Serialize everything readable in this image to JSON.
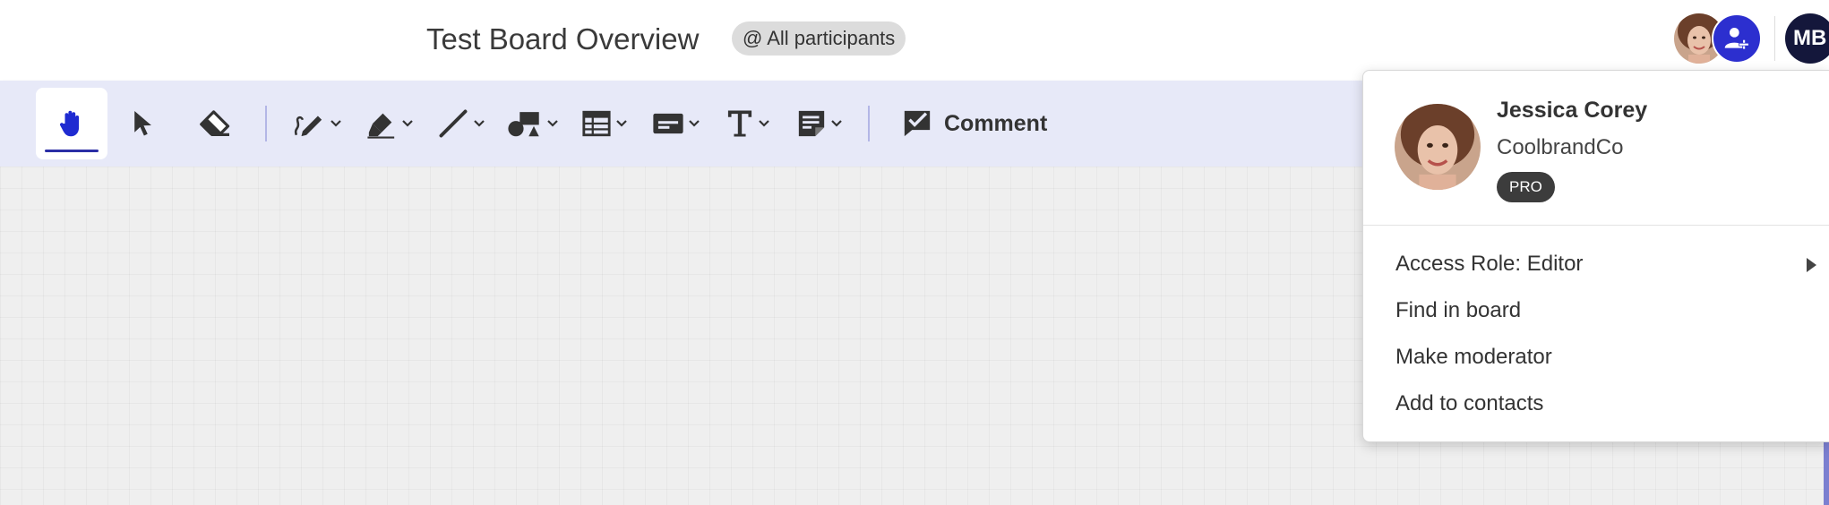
{
  "header": {
    "board_title": "Test Board Overview",
    "participants_chip": "@ All participants",
    "current_user_initials": "MB"
  },
  "toolbar": {
    "tools": [
      {
        "name": "hand-tool",
        "icon": "hand-icon",
        "active": true
      },
      {
        "name": "select-tool",
        "icon": "pointer-icon"
      },
      {
        "name": "eraser-tool",
        "icon": "eraser-icon"
      },
      {
        "name": "pen-tool",
        "icon": "pen-icon",
        "has_dropdown": true
      },
      {
        "name": "highlighter-tool",
        "icon": "highlighter-icon",
        "has_dropdown": true
      },
      {
        "name": "line-tool",
        "icon": "line-icon",
        "has_dropdown": true
      },
      {
        "name": "shapes-tool",
        "icon": "shapes-icon",
        "has_dropdown": true
      },
      {
        "name": "table-tool",
        "icon": "table-icon",
        "has_dropdown": true
      },
      {
        "name": "sticky-tool",
        "icon": "card-icon",
        "has_dropdown": true
      },
      {
        "name": "text-tool",
        "icon": "text-icon",
        "has_dropdown": true
      },
      {
        "name": "note-tool",
        "icon": "note-icon",
        "has_dropdown": true
      }
    ],
    "comment_label": "Comment"
  },
  "profile_popover": {
    "name": "Jessica Corey",
    "company": "CoolbrandCo",
    "badge": "PRO",
    "menu": [
      {
        "label": "Access Role: Editor",
        "has_submenu": true
      },
      {
        "label": "Find in board"
      },
      {
        "label": "Make moderator"
      },
      {
        "label": "Add to contacts"
      }
    ]
  },
  "colors": {
    "accent": "#2c2fcf",
    "toolbar_bg": "#e7e9f8",
    "active_icon": "#1f2bd1",
    "avatar_mb_bg": "#14173b",
    "badge_bg": "#3c3c3c"
  }
}
